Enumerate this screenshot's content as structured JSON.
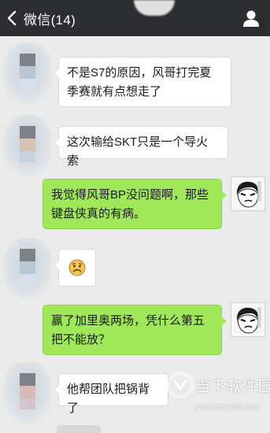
{
  "header": {
    "title": "微信(14)",
    "back_icon": "chevron-left-icon",
    "user_icon": "person-icon"
  },
  "messages": [
    {
      "side": "left",
      "text": "不是S7的原因，风哥打完夏季赛就有点想走了"
    },
    {
      "side": "left",
      "text": "这次输给SKT只是一个导火索"
    },
    {
      "side": "right",
      "text": "我觉得风哥BP没问题啊，那些键盘侠真的有病。"
    },
    {
      "side": "left",
      "emoji": "sad-face-emoji"
    },
    {
      "side": "right",
      "text": "赢了加里奥两场，凭什么第五把不能放？"
    },
    {
      "side": "left",
      "text": "他帮团队把锅背了"
    }
  ],
  "watermark": {
    "name": "当下软件园",
    "url": "www.downxia.com"
  },
  "colors": {
    "topbar": "#2b2d31",
    "background": "#ebebeb",
    "bubble_self": "#a0e75a",
    "bubble_other": "#ffffff"
  }
}
